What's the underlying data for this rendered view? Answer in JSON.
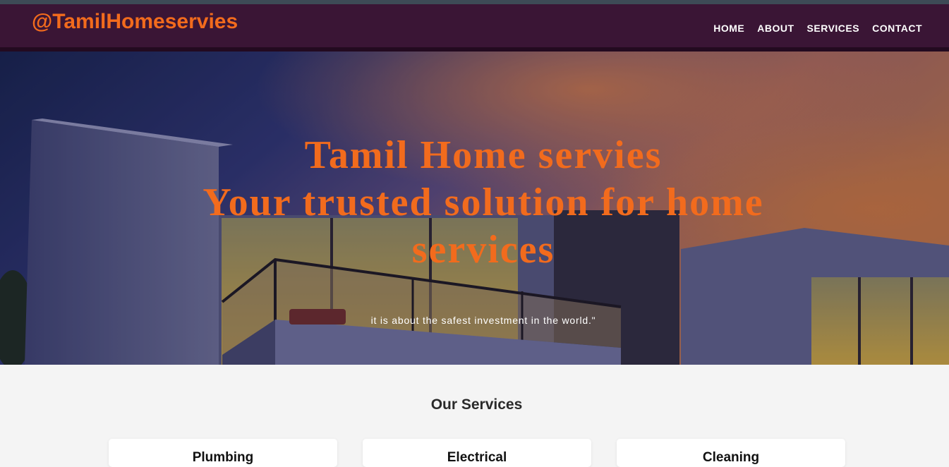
{
  "header": {
    "brand": "@TamilHomeservies",
    "nav": [
      {
        "label": "HOME"
      },
      {
        "label": "ABOUT"
      },
      {
        "label": "SERVICES"
      },
      {
        "label": "CONTACT"
      }
    ]
  },
  "hero": {
    "title_line1": "Tamil Home servies",
    "title_line2": "Your trusted solution for home services",
    "subtitle": "it is about the safest investment in the world.\""
  },
  "services": {
    "heading": "Our Services",
    "cards": [
      {
        "title": "Plumbing"
      },
      {
        "title": "Electrical"
      },
      {
        "title": "Cleaning"
      }
    ]
  },
  "colors": {
    "accent": "#f26b1d",
    "navbar": "#3a1535",
    "page_background": "#f4f4f4"
  }
}
